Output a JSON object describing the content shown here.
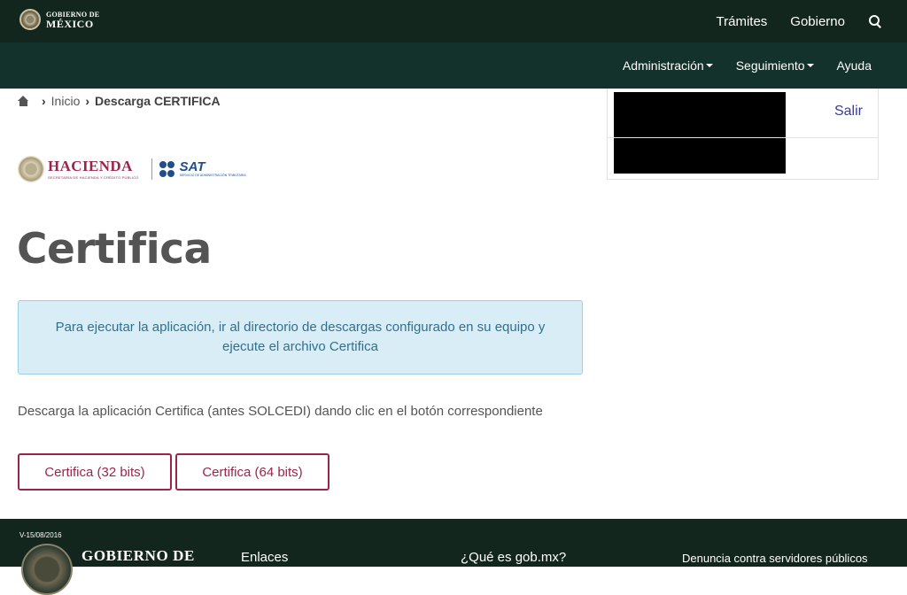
{
  "gov_bar": {
    "logo_small": "GOBIERNO DE",
    "logo_big": "MÉXICO",
    "nav": [
      "Trámites",
      "Gobierno"
    ],
    "search_icon": "search-icon"
  },
  "sub_bar": {
    "items": [
      {
        "label": "Administración",
        "has_caret": true
      },
      {
        "label": "Seguimiento",
        "has_caret": true
      },
      {
        "label": "Ayuda",
        "has_caret": false
      }
    ]
  },
  "breadcrumb": {
    "home_icon": "home-icon",
    "items": [
      "Inicio",
      "Descarga CERTIFICA"
    ]
  },
  "logos": {
    "hacienda_title": "HACIENDA",
    "hacienda_sub": "SECRETARÍA DE HACIENDA Y CRÉDITO PÚBLICO",
    "sat_title": "SAT",
    "sat_sub": "SERVICIO DE ADMINISTRACIÓN TRIBUTARIA"
  },
  "main": {
    "title": "Certifica",
    "alert": "Para ejecutar la aplicación, ir al directorio de descargas configurado en su equipo y ejecute el archivo Certifica",
    "description": "Descarga la aplicación Certifica (antes SOLCEDI) dando clic en el botón correspondiente",
    "buttons": [
      "Certifica (32 bits)",
      "Certifica (64 bits)"
    ]
  },
  "user_panel": {
    "logout": "Salir"
  },
  "footer": {
    "version": "V-15/08/2016",
    "gov": "GOBIERNO DE",
    "links": [
      "Enlaces",
      "¿Qué es gob.mx?",
      "Denuncia contra servidores públicos"
    ]
  },
  "colors": {
    "gov_bar": "#12261d",
    "sub_bar": "#13322b",
    "accent": "#9d2449",
    "alert_bg": "#d9edf7",
    "alert_text": "#31708f"
  }
}
